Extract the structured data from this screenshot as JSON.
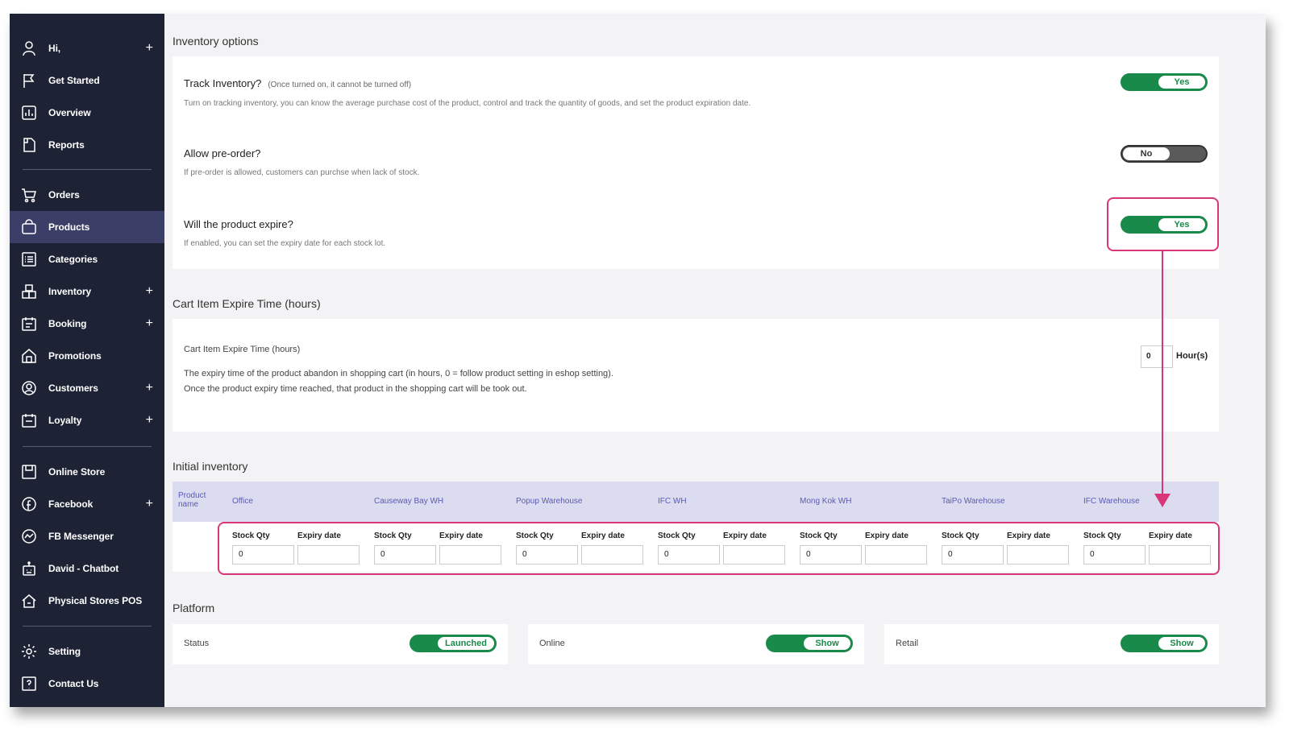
{
  "sidebar": {
    "items": [
      {
        "label": "Hi,",
        "icon": "user-icon",
        "plus": "+"
      },
      {
        "label": "Get Started",
        "icon": "flag-icon"
      },
      {
        "label": "Overview",
        "icon": "chart-icon"
      },
      {
        "label": "Reports",
        "icon": "document-icon"
      },
      {
        "label": "Orders",
        "icon": "cart-icon"
      },
      {
        "label": "Products",
        "icon": "bag-icon"
      },
      {
        "label": "Categories",
        "icon": "list-icon"
      },
      {
        "label": "Inventory",
        "icon": "boxes-icon",
        "plus": "+"
      },
      {
        "label": "Booking",
        "icon": "calendar-icon",
        "plus": "+"
      },
      {
        "label": "Promotions",
        "icon": "store-icon"
      },
      {
        "label": "Customers",
        "icon": "customer-icon",
        "plus": "+"
      },
      {
        "label": "Loyalty",
        "icon": "loyalty-icon",
        "plus": "+"
      },
      {
        "label": "Online Store",
        "icon": "online-store-icon"
      },
      {
        "label": "Facebook",
        "icon": "facebook-icon",
        "plus": "+"
      },
      {
        "label": "FB Messenger",
        "icon": "messenger-icon"
      },
      {
        "label": "David - Chatbot",
        "icon": "chatbot-icon"
      },
      {
        "label": "Physical Stores POS",
        "icon": "house-icon"
      },
      {
        "label": "Setting",
        "icon": "gear-icon"
      },
      {
        "label": "Contact Us",
        "icon": "help-icon"
      }
    ],
    "active": "Products"
  },
  "inventory_options": {
    "title": "Inventory options",
    "track": {
      "title": "Track Inventory?",
      "note": "(Once turned on, it cannot be turned off)",
      "desc": "Turn on tracking inventory, you can know the average purchase cost of the product, control and track the quantity of goods, and set the product expiration date.",
      "toggle": "Yes"
    },
    "preorder": {
      "title": "Allow pre-order?",
      "desc": "If pre-order is allowed, customers can purchse when lack of stock.",
      "toggle": "No"
    },
    "expire": {
      "title": "Will the product expire?",
      "desc": "If enabled, you can set the expiry date for each stock lot.",
      "toggle": "Yes"
    }
  },
  "cart_expire": {
    "title": "Cart Item Expire Time (hours)",
    "label": "Cart Item Expire Time (hours)",
    "desc1": "The expiry time of the product abandon in shopping cart (in hours, 0 = follow product setting in eshop setting).",
    "desc2": "Once the product expiry time reached, that product in the shopping cart will be took out.",
    "value": "0",
    "unit": "Hour(s)"
  },
  "initial_inventory": {
    "title": "Initial inventory",
    "product_name_header": "Product name",
    "stock_qty_label": "Stock Qty",
    "expiry_date_label": "Expiry date",
    "warehouses": [
      {
        "name": "Office",
        "qty": "0",
        "expiry": ""
      },
      {
        "name": "Causeway Bay WH",
        "qty": "0",
        "expiry": ""
      },
      {
        "name": "Popup Warehouse",
        "qty": "0",
        "expiry": ""
      },
      {
        "name": "IFC WH",
        "qty": "0",
        "expiry": ""
      },
      {
        "name": "Mong Kok WH",
        "qty": "0",
        "expiry": ""
      },
      {
        "name": "TaiPo Warehouse",
        "qty": "0",
        "expiry": ""
      },
      {
        "name": "IFC Warehouse",
        "qty": "0",
        "expiry": ""
      }
    ]
  },
  "platform": {
    "title": "Platform",
    "items": [
      {
        "label": "Status",
        "toggle": "Launched"
      },
      {
        "label": "Online",
        "toggle": "Show"
      },
      {
        "label": "Retail",
        "toggle": "Show"
      }
    ]
  },
  "colors": {
    "sidebar_bg": "#1e2235",
    "active_item": "#3b3e66",
    "toggle_on": "#1a8a4a",
    "highlight": "#d9367a",
    "table_header": "#dcdcf0"
  }
}
